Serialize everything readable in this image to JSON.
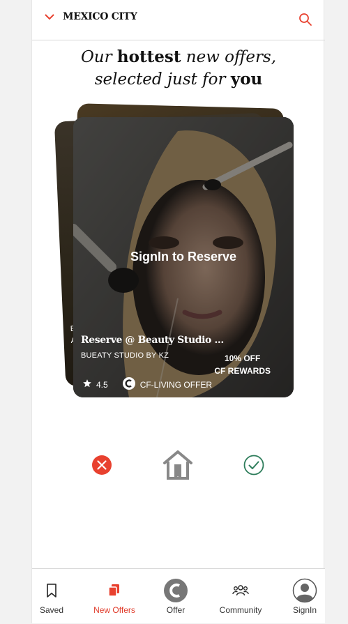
{
  "colors": {
    "brand_red": "#e8412f",
    "accept_green": "#2e7d5b",
    "ink": "#111111"
  },
  "header": {
    "city": "MEXICO CITY",
    "city_icon": "chevron-down-icon",
    "search_icon": "search-icon"
  },
  "headline": {
    "line1": {
      "a": "Our ",
      "b": "hottest",
      "c": " new offers,"
    },
    "line2": {
      "a": "selected just for ",
      "b": "you"
    }
  },
  "back_card": {
    "line1": "B",
    "line2": "A"
  },
  "offer": {
    "overlay_cta": "SignIn to Reserve",
    "title": "Reserve @ Beauty Studio ...",
    "business": "BUEATY STUDIO BY KZ",
    "discount": "10% OFF",
    "rewards": "CF REWARDS",
    "rating": "4.5",
    "badge": "CF-LIVING OFFER"
  },
  "actions": {
    "reject_icon": "close-circle-icon",
    "save_icon": "home-bookmark-icon",
    "accept_icon": "check-circle-icon"
  },
  "nav": {
    "items": [
      {
        "label": "Saved",
        "icon": "bookmark-icon"
      },
      {
        "label": "New Offers",
        "icon": "cards-icon"
      },
      {
        "label": "Offer",
        "icon": "offer-logo-icon"
      },
      {
        "label": "Community",
        "icon": "people-icon"
      },
      {
        "label": "SignIn",
        "icon": "user-avatar-icon"
      }
    ],
    "active_index": 1
  }
}
